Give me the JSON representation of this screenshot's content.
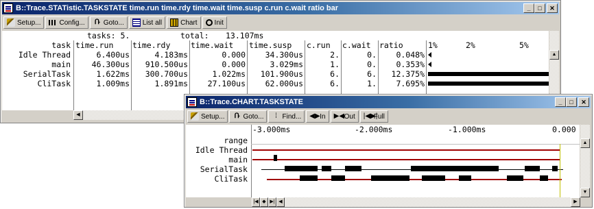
{
  "stat_window": {
    "title": "B::Trace.STATistic.TASKSTATE time.run time.rdy time.wait time.susp c.run c.wait ratio bar",
    "toolbar": [
      {
        "label": "Setup...",
        "icon": "wrench-icon"
      },
      {
        "label": "Config...",
        "icon": "config-icon"
      },
      {
        "label": "Goto...",
        "icon": "goto-icon"
      },
      {
        "label": "List all",
        "icon": "list-icon"
      },
      {
        "label": "Chart",
        "icon": "chart-icon"
      },
      {
        "label": "Init",
        "icon": "init-icon"
      }
    ],
    "summary": {
      "tasks_label": "tasks: 5.",
      "total_label": "total:",
      "total_value": "13.107ms"
    },
    "headers": {
      "task": "task",
      "time_run": "time.run",
      "time_rdy": "time.rdy",
      "time_wait": "time.wait",
      "time_susp": "time.susp",
      "c_run": "c.run",
      "c_wait": "c.wait",
      "ratio": "ratio",
      "p1": "1%",
      "p2": "2%",
      "p5": "5%"
    },
    "rows": [
      {
        "task": "Idle Thread",
        "time_run": "6.400us",
        "time_rdy": "4.183ms",
        "time_wait": "0.000",
        "time_susp": "34.300us",
        "c_run": "2.",
        "c_wait": "0.",
        "ratio": "0.048%",
        "bar_pct": 0.048
      },
      {
        "task": "main",
        "time_run": "46.300us",
        "time_rdy": "910.500us",
        "time_wait": "0.000",
        "time_susp": "3.029ms",
        "c_run": "1.",
        "c_wait": "0.",
        "ratio": "0.353%",
        "bar_pct": 0.353
      },
      {
        "task": "SerialTask",
        "time_run": "1.622ms",
        "time_rdy": "300.700us",
        "time_wait": "1.022ms",
        "time_susp": "101.900us",
        "c_run": "6.",
        "c_wait": "6.",
        "ratio": "12.375%",
        "bar_pct": 12.375
      },
      {
        "task": "CliTask",
        "time_run": "1.009ms",
        "time_rdy": "1.891ms",
        "time_wait": "27.100us",
        "time_susp": "62.000us",
        "c_run": "6.",
        "c_wait": "1.",
        "ratio": "7.695%",
        "bar_pct": 7.695
      }
    ]
  },
  "chart_window": {
    "title": "B::Trace.CHART.TASKSTATE",
    "toolbar": [
      {
        "label": "Setup...",
        "icon": "wrench-icon"
      },
      {
        "label": "Goto...",
        "icon": "goto-icon"
      },
      {
        "label": "Find...",
        "icon": "find-icon"
      },
      {
        "label": "In",
        "icon": "zoom-in-icon"
      },
      {
        "label": "Out",
        "icon": "zoom-out-icon"
      },
      {
        "label": "Full",
        "icon": "zoom-full-icon"
      }
    ],
    "axis_labels": [
      "-3.000ms",
      "-2.000ms",
      "-1.000ms",
      "0.000"
    ],
    "range_label": "range",
    "tasks": [
      "Idle Thread",
      "main",
      "SerialTask",
      "CliTask"
    ]
  },
  "colors": {
    "title_active": "#0a246a",
    "window_face": "#d4d0c8",
    "trace_red": "#a00000"
  }
}
